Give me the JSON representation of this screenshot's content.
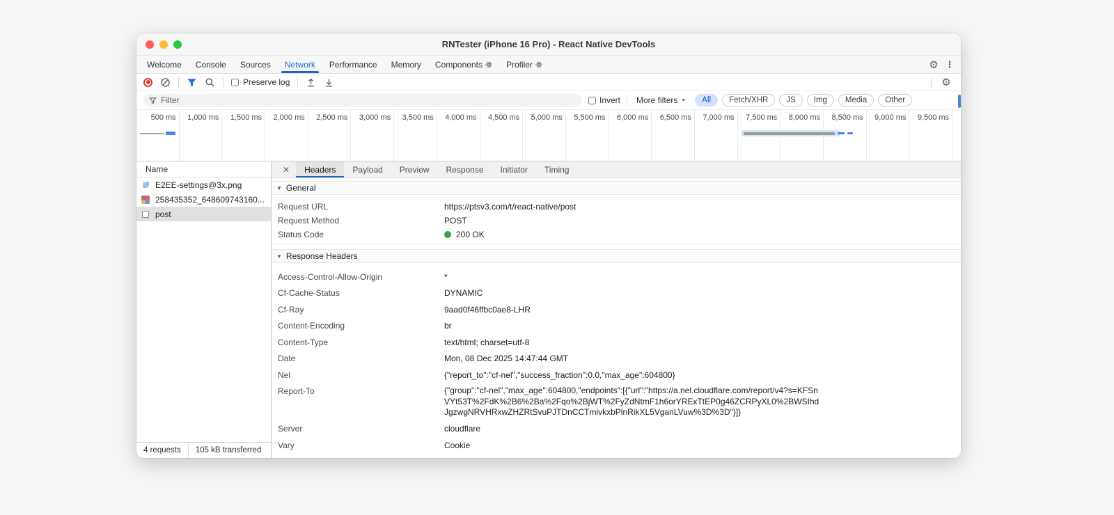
{
  "titlebar": {
    "title": "RNTester (iPhone 16 Pro) - React Native DevTools"
  },
  "icons": {
    "gear": "⚙",
    "kebab": "⋮",
    "close": "✕",
    "caret": "▼",
    "triangle": "▼"
  },
  "main_tabs": {
    "items": [
      {
        "label": "Welcome"
      },
      {
        "label": "Console"
      },
      {
        "label": "Sources"
      },
      {
        "label": "Network",
        "active": true
      },
      {
        "label": "Performance"
      },
      {
        "label": "Memory"
      },
      {
        "label": "Components",
        "react": true
      },
      {
        "label": "Profiler",
        "react": true
      }
    ]
  },
  "toolbar": {
    "preserve_log": "Preserve log"
  },
  "filter_bar": {
    "placeholder": "Filter",
    "invert_label": "Invert",
    "more_filters_label": "More filters",
    "chips": [
      {
        "label": "All",
        "active": true
      },
      {
        "label": "Fetch/XHR"
      },
      {
        "label": "JS"
      },
      {
        "label": "Img"
      },
      {
        "label": "Media"
      },
      {
        "label": "Other"
      }
    ]
  },
  "timeline": {
    "labels": [
      "500 ms",
      "1,000 ms",
      "1,500 ms",
      "2,000 ms",
      "2,500 ms",
      "3,000 ms",
      "3,500 ms",
      "4,000 ms",
      "4,500 ms",
      "5,000 ms",
      "5,500 ms",
      "6,000 ms",
      "6,500 ms",
      "7,000 ms",
      "7,500 ms",
      "8,000 ms",
      "8,500 ms",
      "9,000 ms",
      "9,500 ms"
    ]
  },
  "request_list": {
    "header": "Name",
    "rows": [
      {
        "label": "E2EE-settings@3x.png",
        "icon": "image-icon"
      },
      {
        "label": "258435352_648609743160...",
        "icon": "image-thumb-icon"
      },
      {
        "label": "post",
        "icon": "document-icon",
        "selected": true
      }
    ],
    "status": {
      "requests": "4 requests",
      "transferred": "105 kB transferred"
    }
  },
  "detail": {
    "tabs": [
      {
        "label": "Headers",
        "active": true
      },
      {
        "label": "Payload"
      },
      {
        "label": "Preview"
      },
      {
        "label": "Response"
      },
      {
        "label": "Initiator"
      },
      {
        "label": "Timing"
      }
    ],
    "general": {
      "title": "General",
      "rows": [
        {
          "name": "Request URL",
          "value": "https://ptsv3.com/t/react-native/post"
        },
        {
          "name": "Request Method",
          "value": "POST"
        },
        {
          "name": "Status Code",
          "value": "200 OK",
          "green_dot": true
        }
      ]
    },
    "response_headers": {
      "title": "Response Headers",
      "rows": [
        {
          "name": "Access-Control-Allow-Origin",
          "value": "*"
        },
        {
          "name": "Cf-Cache-Status",
          "value": "DYNAMIC"
        },
        {
          "name": "Cf-Ray",
          "value": "9aad0f46ffbc0ae8-LHR"
        },
        {
          "name": "Content-Encoding",
          "value": "br"
        },
        {
          "name": "Content-Type",
          "value": "text/html; charset=utf-8"
        },
        {
          "name": "Date",
          "value": "Mon, 08 Dec 2025 14:47:44 GMT"
        },
        {
          "name": "Nel",
          "value": "{\"report_to\":\"cf-nel\",\"success_fraction\":0.0,\"max_age\":604800}"
        },
        {
          "name": "Report-To",
          "value": "{\"group\":\"cf-nel\",\"max_age\":604800,\"endpoints\":[{\"url\":\"https://a.nel.cloudflare.com/report/v4?s=KFSnVYt53T%2FdK%2B6%2Ba%2Fqo%2BjWT%2FyZdNtmF1h6orYRExTtEP0g46ZCRPyXL0%2BWSIhdJgzwgNRVHRxwZHZRtSvuPJTDnCCTmivkxbPlnRikXL5VganLVuw%3D%3D\"}]}",
          "wrap": true
        },
        {
          "name": "Server",
          "value": "cloudflare"
        },
        {
          "name": "Vary",
          "value": "Cookie"
        }
      ]
    }
  },
  "colors": {
    "accent": "#1a66d1",
    "status_green": "#2ea149",
    "record_red": "#e0382b",
    "selected_chip_bg": "#d3e3fd",
    "selected_chip_text": "#0b57d0"
  }
}
